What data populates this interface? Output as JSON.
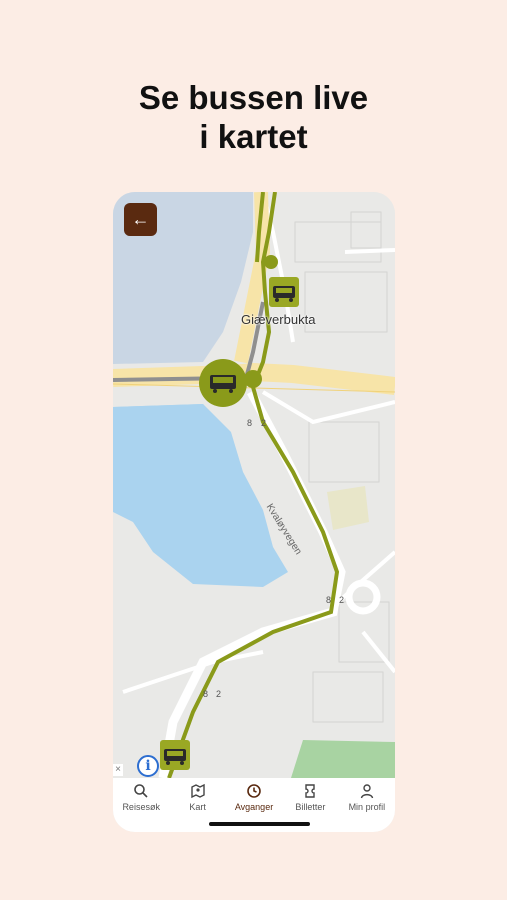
{
  "headline": {
    "line1": "Se bussen live",
    "line2": "i kartet"
  },
  "map": {
    "stop_name": "Giæverbukta",
    "road_name": "Kvaløyvegen",
    "road_numbers": [
      "8",
      "2",
      "8",
      "2",
      "8",
      "2"
    ],
    "route_color": "#8a9a1a",
    "bus_color": "#9aa824"
  },
  "back_button": {
    "icon": "arrow-left-icon"
  },
  "nav": {
    "items": [
      {
        "label": "Reisesøk",
        "icon": "search-icon"
      },
      {
        "label": "Kart",
        "icon": "map-icon"
      },
      {
        "label": "Avganger",
        "icon": "clock-icon"
      },
      {
        "label": "Billetter",
        "icon": "ticket-icon"
      },
      {
        "label": "Min profil",
        "icon": "person-icon"
      }
    ],
    "active": "Avganger"
  }
}
